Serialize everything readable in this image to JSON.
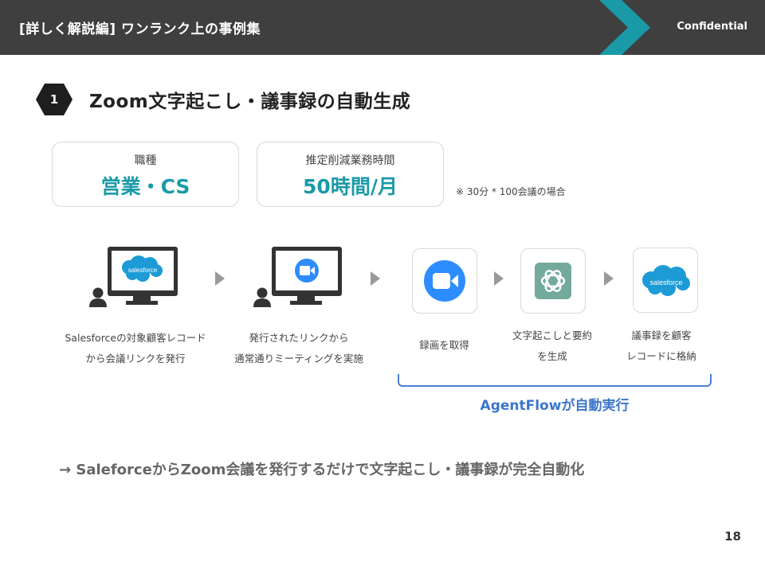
{
  "header": {
    "title": "[詳しく解説編] ワンランク上の事例集",
    "confidential": "Confidential",
    "colors": {
      "background": "#3f3f3f",
      "accent": "#1a9aa7"
    }
  },
  "section": {
    "number": "1",
    "title": "Zoom文字起こし・議事録の自動生成"
  },
  "cards": [
    {
      "label": "職種",
      "value": "営業・CS"
    },
    {
      "label": "推定削減業務時間",
      "value": "50時間/月"
    }
  ],
  "card_note": "※ 30分 * 100会議の場合",
  "flow": {
    "icons": {
      "salesforce_logo": "salesforce",
      "zoom": "zoom-camera-icon",
      "chatgpt": "openai-knot-icon"
    },
    "steps": [
      {
        "caption_line1": "Salesforceの対象顧客レコード",
        "caption_line2": "から会議リンクを発行"
      },
      {
        "caption_line1": "発行されたリンクから",
        "caption_line2": "通常通りミーティングを実施"
      },
      {
        "caption_line1": "録画を取得",
        "caption_line2": ""
      },
      {
        "caption_line1": "文字起こしと要約",
        "caption_line2": "を生成"
      },
      {
        "caption_line1": "議事録を顧客",
        "caption_line2": "レコードに格納"
      }
    ],
    "agent_label": "AgentFlowが自動実行"
  },
  "conclusion": "→ SaleforceからZoom会議を発行するだけで文字起こし・議事録が完全自動化",
  "page_number": "18"
}
